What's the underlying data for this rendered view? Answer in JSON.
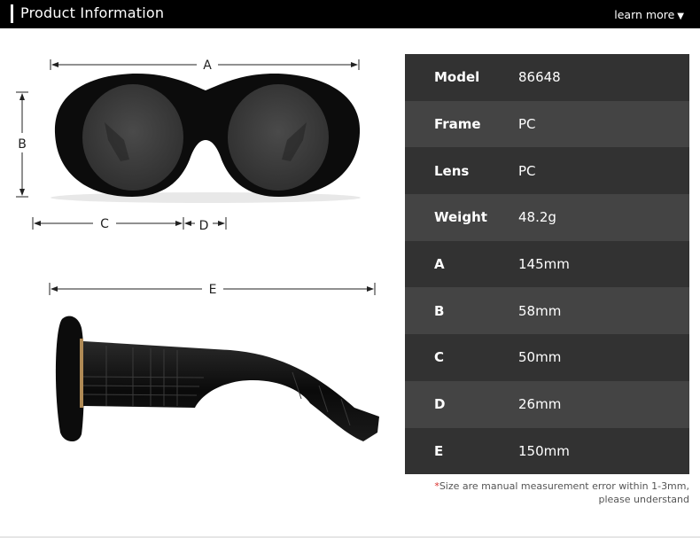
{
  "header": {
    "title": "Product Information",
    "learn_more": "learn more",
    "learn_more_icon": "triangle-down-icon"
  },
  "diagram": {
    "front_view": {
      "labels": {
        "width": "A",
        "height": "B",
        "lens_width": "C",
        "bridge": "D"
      }
    },
    "side_view": {
      "labels": {
        "temple_length": "E"
      }
    }
  },
  "specs": [
    {
      "label": "Model",
      "value": "86648"
    },
    {
      "label": "Frame",
      "value": "PC"
    },
    {
      "label": "Lens",
      "value": "PC"
    },
    {
      "label": "Weight",
      "value": "48.2g"
    },
    {
      "label": "A",
      "value": "145mm"
    },
    {
      "label": "B",
      "value": "58mm"
    },
    {
      "label": "C",
      "value": "50mm"
    },
    {
      "label": "D",
      "value": "26mm"
    },
    {
      "label": "E",
      "value": "150mm"
    }
  ],
  "note": {
    "star": "*",
    "line1": "Size are manual measurement error within 1-3mm,",
    "line2": "please understand"
  },
  "colors": {
    "row_dark": "#323232",
    "row_light": "#444444",
    "accent_star": "#d9302c"
  }
}
